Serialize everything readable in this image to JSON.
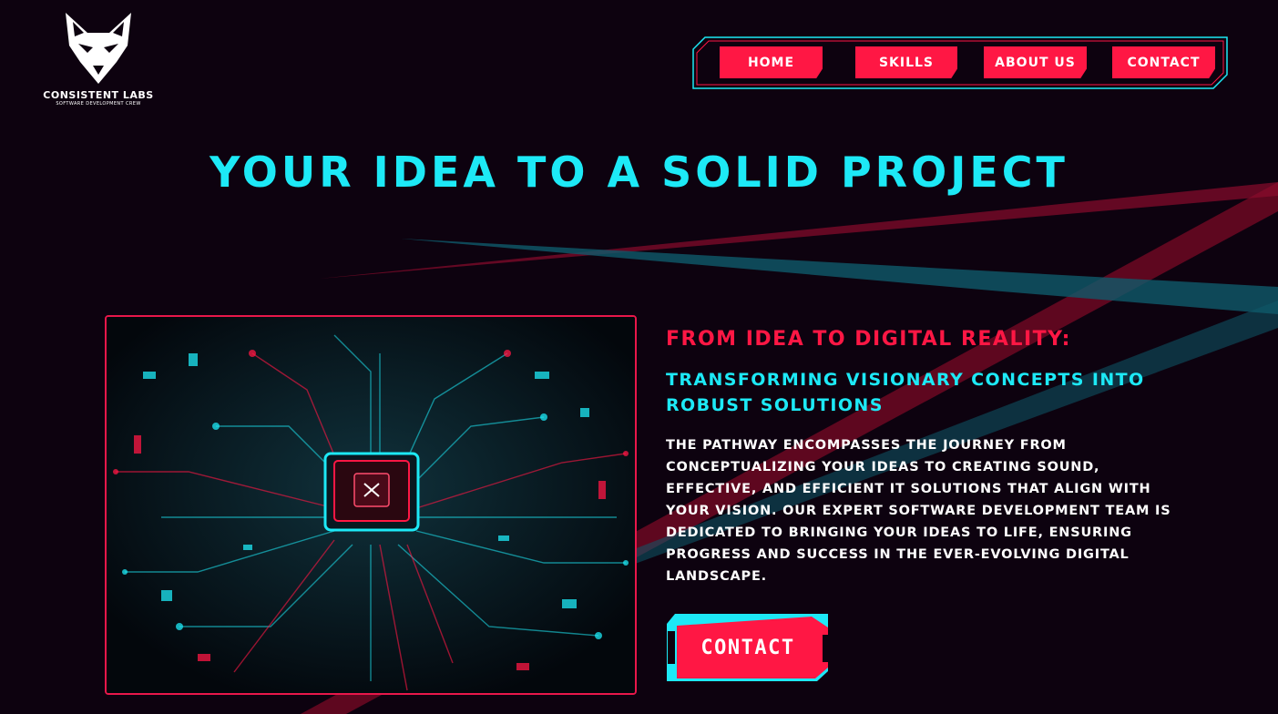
{
  "brand": {
    "name": "CONSISTENT LABS",
    "tagline": "SOFTWARE DEVELOPMENT CREW"
  },
  "nav": {
    "items": [
      {
        "label": "HOME"
      },
      {
        "label": "SKILLS"
      },
      {
        "label": "ABOUT US"
      },
      {
        "label": "CONTACT"
      }
    ]
  },
  "hero": {
    "headline": "YOUR IDEA TO A SOLID PROJECT",
    "subheading": "FROM IDEA TO DIGITAL REALITY:",
    "subheading2": "TRANSFORMING VISIONARY CONCEPTS INTO ROBUST SOLUTIONS",
    "body": "THE PATHWAY ENCOMPASSES THE JOURNEY FROM CONCEPTUALIZING YOUR IDEAS TO CREATING SOUND, EFFECTIVE, AND EFFICIENT IT SOLUTIONS THAT ALIGN WITH YOUR VISION. OUR EXPERT SOFTWARE DEVELOPMENT TEAM IS DEDICATED TO BRINGING YOUR IDEAS TO LIFE, ENSURING PROGRESS AND SUCCESS IN THE EVER-EVOLVING DIGITAL LANDSCAPE.",
    "cta_label": "CONTACT",
    "image_icon": "circuit-board-chip"
  },
  "colors": {
    "background": "#0d020f",
    "accent_red": "#ff1744",
    "accent_cyan": "#1de9f6",
    "text": "#ffffff"
  }
}
